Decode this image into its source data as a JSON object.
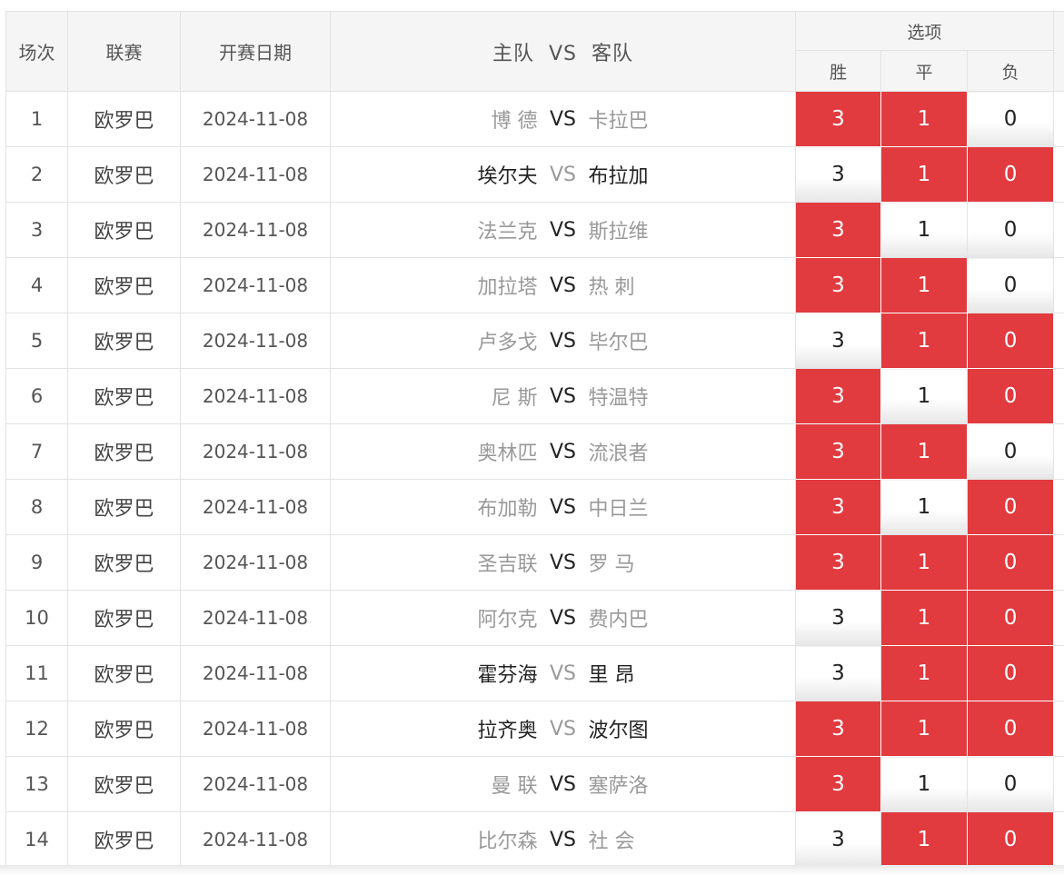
{
  "header": {
    "col_no": "场次",
    "col_league": "联赛",
    "col_date": "开赛日期",
    "col_teams": "主队  VS  客队",
    "col_options": "选项",
    "opt_win": "胜",
    "opt_draw": "平",
    "opt_loss": "负"
  },
  "colors": {
    "selected": "#e13a3f",
    "vs_emphasis": "#222222",
    "muted": "#999999"
  },
  "rows": [
    {
      "no": "1",
      "league": "欧罗巴",
      "date": "2024-11-08",
      "home": "博 德",
      "vs": "VS",
      "away": "卡拉巴",
      "win": "3",
      "draw": "1",
      "loss": "0",
      "win_sel": true,
      "draw_sel": true,
      "loss_sel": false,
      "emph": "none"
    },
    {
      "no": "2",
      "league": "欧罗巴",
      "date": "2024-11-08",
      "home": "埃尔夫",
      "vs": "VS",
      "away": "布拉加",
      "win": "3",
      "draw": "1",
      "loss": "0",
      "win_sel": false,
      "draw_sel": true,
      "loss_sel": true,
      "emph": "both"
    },
    {
      "no": "3",
      "league": "欧罗巴",
      "date": "2024-11-08",
      "home": "法兰克",
      "vs": "VS",
      "away": "斯拉维",
      "win": "3",
      "draw": "1",
      "loss": "0",
      "win_sel": true,
      "draw_sel": false,
      "loss_sel": false,
      "emph": "none"
    },
    {
      "no": "4",
      "league": "欧罗巴",
      "date": "2024-11-08",
      "home": "加拉塔",
      "vs": "VS",
      "away": "热 刺",
      "win": "3",
      "draw": "1",
      "loss": "0",
      "win_sel": true,
      "draw_sel": true,
      "loss_sel": false,
      "emph": "none"
    },
    {
      "no": "5",
      "league": "欧罗巴",
      "date": "2024-11-08",
      "home": "卢多戈",
      "vs": "VS",
      "away": "毕尔巴",
      "win": "3",
      "draw": "1",
      "loss": "0",
      "win_sel": false,
      "draw_sel": true,
      "loss_sel": true,
      "emph": "none"
    },
    {
      "no": "6",
      "league": "欧罗巴",
      "date": "2024-11-08",
      "home": "尼 斯",
      "vs": "VS",
      "away": "特温特",
      "win": "3",
      "draw": "1",
      "loss": "0",
      "win_sel": true,
      "draw_sel": false,
      "loss_sel": true,
      "emph": "none"
    },
    {
      "no": "7",
      "league": "欧罗巴",
      "date": "2024-11-08",
      "home": "奥林匹",
      "vs": "VS",
      "away": "流浪者",
      "win": "3",
      "draw": "1",
      "loss": "0",
      "win_sel": true,
      "draw_sel": true,
      "loss_sel": false,
      "emph": "none"
    },
    {
      "no": "8",
      "league": "欧罗巴",
      "date": "2024-11-08",
      "home": "布加勒",
      "vs": "VS",
      "away": "中日兰",
      "win": "3",
      "draw": "1",
      "loss": "0",
      "win_sel": true,
      "draw_sel": false,
      "loss_sel": true,
      "emph": "none"
    },
    {
      "no": "9",
      "league": "欧罗巴",
      "date": "2024-11-08",
      "home": "圣吉联",
      "vs": "VS",
      "away": "罗 马",
      "win": "3",
      "draw": "1",
      "loss": "0",
      "win_sel": true,
      "draw_sel": true,
      "loss_sel": true,
      "emph": "none"
    },
    {
      "no": "10",
      "league": "欧罗巴",
      "date": "2024-11-08",
      "home": "阿尔克",
      "vs": "VS",
      "away": "费内巴",
      "win": "3",
      "draw": "1",
      "loss": "0",
      "win_sel": false,
      "draw_sel": true,
      "loss_sel": true,
      "emph": "none"
    },
    {
      "no": "11",
      "league": "欧罗巴",
      "date": "2024-11-08",
      "home": "霍芬海",
      "vs": "VS",
      "away": "里 昂",
      "win": "3",
      "draw": "1",
      "loss": "0",
      "win_sel": false,
      "draw_sel": true,
      "loss_sel": true,
      "emph": "both"
    },
    {
      "no": "12",
      "league": "欧罗巴",
      "date": "2024-11-08",
      "home": "拉齐奥",
      "vs": "VS",
      "away": "波尔图",
      "win": "3",
      "draw": "1",
      "loss": "0",
      "win_sel": true,
      "draw_sel": true,
      "loss_sel": true,
      "emph": "both"
    },
    {
      "no": "13",
      "league": "欧罗巴",
      "date": "2024-11-08",
      "home": "曼 联",
      "vs": "VS",
      "away": "塞萨洛",
      "win": "3",
      "draw": "1",
      "loss": "0",
      "win_sel": true,
      "draw_sel": false,
      "loss_sel": false,
      "emph": "none"
    },
    {
      "no": "14",
      "league": "欧罗巴",
      "date": "2024-11-08",
      "home": "比尔森",
      "vs": "VS",
      "away": "社 会",
      "win": "3",
      "draw": "1",
      "loss": "0",
      "win_sel": false,
      "draw_sel": true,
      "loss_sel": true,
      "emph": "none"
    }
  ]
}
